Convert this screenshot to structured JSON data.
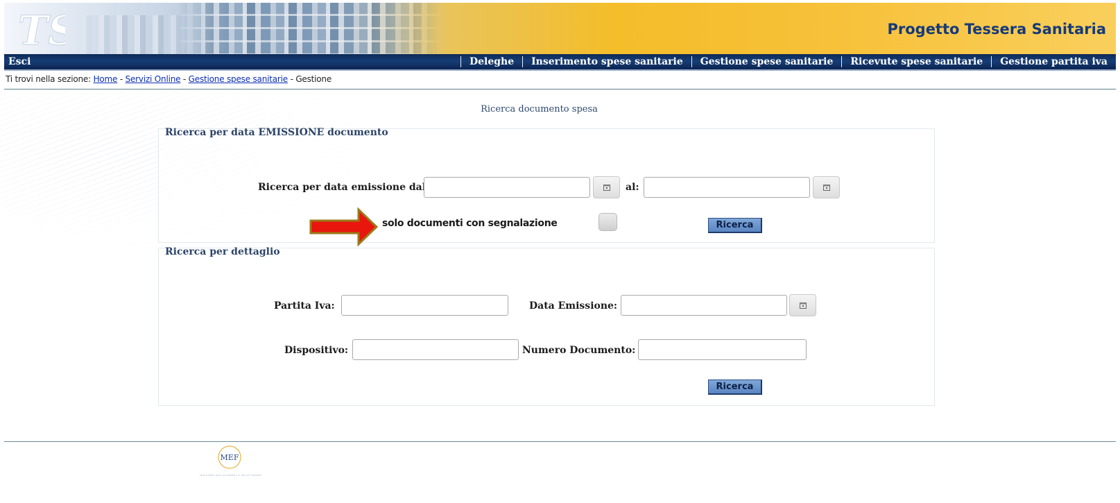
{
  "header": {
    "logo_text": "TS",
    "title": "Progetto Tessera Sanitaria"
  },
  "nav": {
    "exit_label": "Esci",
    "items": [
      {
        "label": "Deleghe"
      },
      {
        "label": "Inserimento spese sanitarie"
      },
      {
        "label": "Gestione spese sanitarie"
      },
      {
        "label": "Ricevute spese sanitarie"
      },
      {
        "label": "Gestione partita iva"
      }
    ]
  },
  "breadcrumb": {
    "prefix": "Ti trovi nella sezione:",
    "separator": " - ",
    "links": [
      "Home",
      "Servizi Online",
      "Gestione spese sanitarie"
    ],
    "current": "Gestione"
  },
  "main": {
    "page_title": "Ricerca documento spesa",
    "section_date": {
      "title": "Ricerca per data EMISSIONE documento",
      "from_label": "Ricerca per data emissione dal:",
      "from_value": "",
      "to_label": "al:",
      "to_value": "",
      "only_flagged_label": "solo documenti con segnalazione",
      "only_flagged_checked": false,
      "search_button": "Ricerca"
    },
    "section_detail": {
      "title": "Ricerca per dettaglio",
      "vat_label": "Partita Iva:",
      "vat_value": "",
      "issue_date_label": "Data Emissione:",
      "issue_date_value": "",
      "device_label": "Dispositivo:",
      "device_value": "",
      "doc_number_label": "Numero Documento:",
      "doc_number_value": "",
      "search_button": "Ricerca"
    }
  },
  "footer": {
    "logo_text": "MEF",
    "caption": "MINISTERO DELL'ECONOMIA E DELLE FINANZE"
  },
  "colors": {
    "nav_bg": "#163d76",
    "title_blue": "#163a7a",
    "arrow_red": "#e8160c",
    "arrow_border": "#9a7a1a",
    "button_blue": "#6b95cc"
  }
}
